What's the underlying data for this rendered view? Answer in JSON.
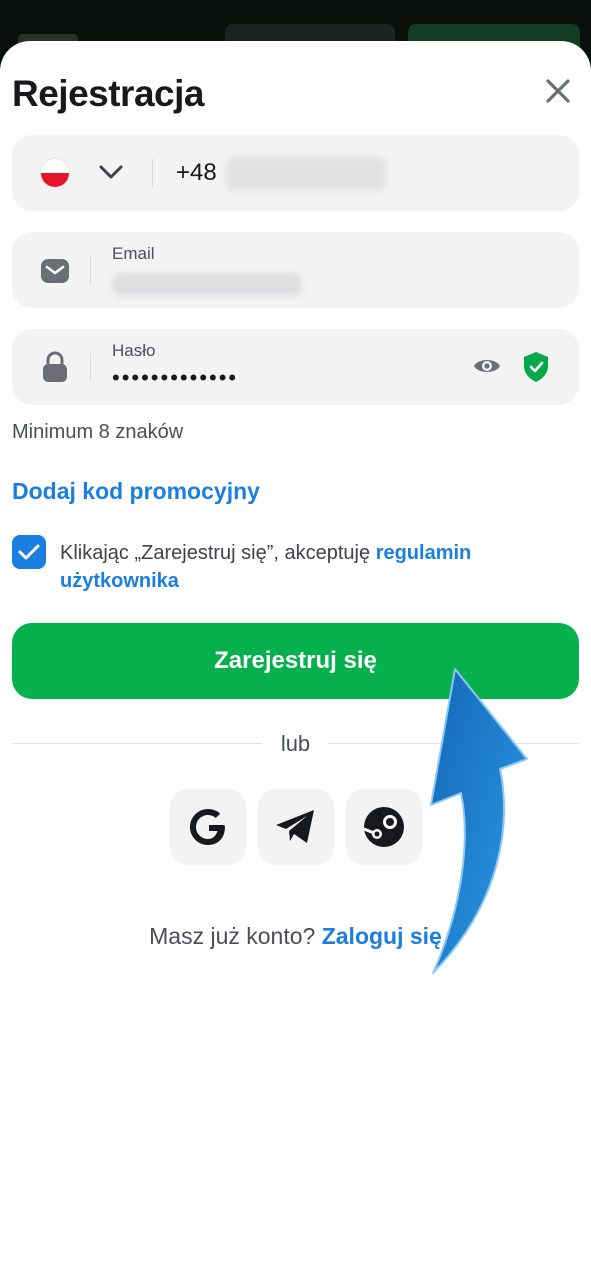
{
  "modal": {
    "title": "Rejestracja"
  },
  "phone": {
    "prefix": "+48",
    "country_flag": "poland-flag-icon"
  },
  "email": {
    "label": "Email"
  },
  "password": {
    "label": "Hasło",
    "masked_value": "•••••••••••••",
    "hint": "Minimum 8 znaków"
  },
  "promo": {
    "link_label": "Dodaj kod promocyjny"
  },
  "terms": {
    "checked": true,
    "text": "Klikając „Zarejestruj się”, akceptuję",
    "link_label": "regulamin użytkownika"
  },
  "register_button": {
    "label": "Zarejestruj się"
  },
  "divider": {
    "label": "lub"
  },
  "social": [
    {
      "icon": "google-icon"
    },
    {
      "icon": "telegram-icon"
    },
    {
      "icon": "steam-icon"
    }
  ],
  "login_prompt": {
    "text": "Masz już konto?",
    "link_label": "Zaloguj się"
  },
  "colors": {
    "accent_blue": "#1a7fe0",
    "brand_green": "#05b04d",
    "field_bg": "#f3f3f4",
    "arrow_blue": "#1f86d6"
  }
}
